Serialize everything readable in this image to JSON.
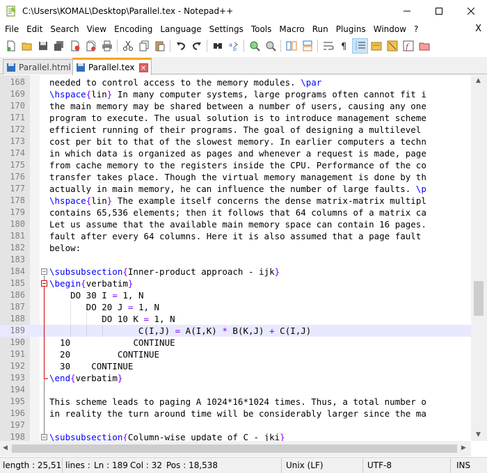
{
  "window": {
    "title": "C:\\Users\\KOMAL\\Desktop\\Parallel.tex - Notepad++",
    "minimize": "─",
    "maximize": "☐",
    "close": "✕"
  },
  "menu": {
    "items": [
      "File",
      "Edit",
      "Search",
      "View",
      "Encoding",
      "Language",
      "Settings",
      "Tools",
      "Macro",
      "Run",
      "Plugins",
      "Window",
      "?"
    ],
    "close_doc": "X"
  },
  "toolbar": {
    "icons": [
      "new-file-icon",
      "open-file-icon",
      "save-icon",
      "save-all-icon",
      "close-icon",
      "close-all-icon",
      "print-icon",
      "cut-icon",
      "copy-icon",
      "paste-icon",
      "undo-icon",
      "redo-icon",
      "find-icon",
      "replace-icon",
      "zoom-in-icon",
      "zoom-out-icon",
      "sync-v-icon",
      "sync-h-icon",
      "word-wrap-icon",
      "show-all-chars-icon",
      "indent-guide-icon",
      "udl-icon",
      "doc-map-icon",
      "function-list-icon",
      "folder-workspace-icon"
    ]
  },
  "tabs": [
    {
      "label": "Parallel.html",
      "active": false,
      "close": "✕"
    },
    {
      "label": "Parallel.tex",
      "active": true,
      "close": "✕"
    }
  ],
  "editor": {
    "current_line": 189,
    "lines": [
      {
        "n": "168",
        "segs": [
          [
            "t",
            "needed to control access to the memory modules. "
          ],
          [
            "k",
            "\\par"
          ]
        ]
      },
      {
        "n": "169",
        "segs": [
          [
            "k",
            "\\hspace"
          ],
          [
            "b",
            "{"
          ],
          [
            "t",
            "lin"
          ],
          [
            "b",
            "}"
          ],
          [
            "t",
            " In many computer systems, large programs often cannot fit i"
          ]
        ]
      },
      {
        "n": "170",
        "segs": [
          [
            "t",
            "the main memory may be shared between a number of users, causing any one"
          ]
        ]
      },
      {
        "n": "171",
        "segs": [
          [
            "t",
            "program to execute. The usual solution is to introduce management scheme"
          ]
        ]
      },
      {
        "n": "172",
        "segs": [
          [
            "t",
            "efficient running of their programs. The goal of designing a multilevel "
          ]
        ]
      },
      {
        "n": "173",
        "segs": [
          [
            "t",
            "cost per bit to that of the slowest memory. In earlier computers a techn"
          ]
        ]
      },
      {
        "n": "174",
        "segs": [
          [
            "t",
            "in which data is organized as pages and whenever a request is made, page"
          ]
        ]
      },
      {
        "n": "175",
        "segs": [
          [
            "t",
            "from cache memory to the registers inside the CPU. Performance of the co"
          ]
        ]
      },
      {
        "n": "176",
        "segs": [
          [
            "t",
            "transfer takes place. Though the virtual memory management is done by th"
          ]
        ]
      },
      {
        "n": "177",
        "segs": [
          [
            "t",
            "actually in main memory, he can influence the number of large faults. "
          ],
          [
            "k",
            "\\p"
          ]
        ]
      },
      {
        "n": "178",
        "segs": [
          [
            "k",
            "\\hspace"
          ],
          [
            "b",
            "{"
          ],
          [
            "t",
            "lin"
          ],
          [
            "b",
            "}"
          ],
          [
            "t",
            " The example itself concerns the dense matrix-matrix multipl"
          ]
        ]
      },
      {
        "n": "179",
        "segs": [
          [
            "t",
            "contains 65,536 elements; then it follows that 64 columns of a matrix ca"
          ]
        ]
      },
      {
        "n": "180",
        "segs": [
          [
            "t",
            "Let us assume that the available main memory space can contain 16 pages."
          ]
        ]
      },
      {
        "n": "181",
        "segs": [
          [
            "t",
            "fault after every 64 columns. Here it is also assumed that a page fault "
          ]
        ]
      },
      {
        "n": "182",
        "segs": [
          [
            "t",
            "below:"
          ]
        ]
      },
      {
        "n": "183",
        "segs": []
      },
      {
        "n": "184",
        "segs": [
          [
            "k",
            "\\subsubsection"
          ],
          [
            "b",
            "{"
          ],
          [
            "t",
            "Inner-product approach - ijk"
          ],
          [
            "b",
            "}"
          ]
        ]
      },
      {
        "n": "185",
        "segs": [
          [
            "k",
            "\\begin"
          ],
          [
            "b",
            "{"
          ],
          [
            "t",
            "verbatim"
          ],
          [
            "b",
            "}"
          ]
        ]
      },
      {
        "n": "186",
        "segs": [
          [
            "t",
            "    DO 30 I "
          ],
          [
            "o",
            "="
          ],
          [
            "t",
            " 1, N"
          ]
        ]
      },
      {
        "n": "187",
        "segs": [
          [
            "t",
            "       DO 20 J "
          ],
          [
            "o",
            "="
          ],
          [
            "t",
            " 1, N"
          ]
        ]
      },
      {
        "n": "188",
        "segs": [
          [
            "t",
            "          DO 10 K "
          ],
          [
            "o",
            "="
          ],
          [
            "t",
            " 1, N"
          ]
        ]
      },
      {
        "n": "189",
        "segs": [
          [
            "t",
            "                 C(I,J) "
          ],
          [
            "o",
            "="
          ],
          [
            "t",
            " A(I,K) "
          ],
          [
            "o",
            "*"
          ],
          [
            "t",
            " B(K,J) "
          ],
          [
            "o",
            "+"
          ],
          [
            "t",
            " C(I,J)"
          ]
        ]
      },
      {
        "n": "190",
        "segs": [
          [
            "t",
            "  10            CONTINUE"
          ]
        ]
      },
      {
        "n": "191",
        "segs": [
          [
            "t",
            "  20         CONTINUE"
          ]
        ]
      },
      {
        "n": "192",
        "segs": [
          [
            "t",
            "  30    CONTINUE"
          ]
        ]
      },
      {
        "n": "193",
        "segs": [
          [
            "k",
            "\\end"
          ],
          [
            "b",
            "{"
          ],
          [
            "t",
            "verbatim"
          ],
          [
            "b",
            "}"
          ]
        ]
      },
      {
        "n": "194",
        "segs": []
      },
      {
        "n": "195",
        "segs": [
          [
            "t",
            "This scheme leads to paging A 1024*16*1024 times. Thus, a total number o"
          ]
        ]
      },
      {
        "n": "196",
        "segs": [
          [
            "t",
            "in reality the turn around time will be considerably larger since the ma"
          ]
        ]
      },
      {
        "n": "197",
        "segs": []
      },
      {
        "n": "198",
        "segs": [
          [
            "k",
            "\\subsubsection"
          ],
          [
            "b",
            "{"
          ],
          [
            "t",
            "Column-wise update of C - jki"
          ],
          [
            "b",
            "}"
          ]
        ]
      }
    ]
  },
  "status": {
    "length": "length : 25,517",
    "lines": "lines :",
    "ln": "Ln : 189",
    "col": "Col : 32",
    "pos": "Pos : 18,538",
    "eol": "Unix (LF)",
    "encoding": "UTF-8",
    "mode": "INS"
  },
  "colors": {
    "keyword": "#0000ff",
    "brace": "#8000ff",
    "current_line": "#e8e8ff",
    "tab_accent": "#f5a623"
  }
}
